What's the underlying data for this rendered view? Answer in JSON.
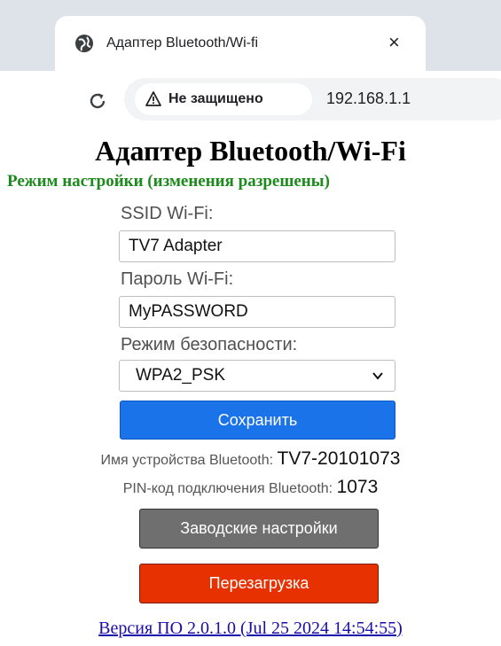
{
  "browser": {
    "tab": {
      "title": "Адаптер Bluetooth/Wi-fi",
      "favicon": "globe-icon",
      "close": "×"
    },
    "toolbar": {
      "reload_icon": "reload-icon",
      "security_label": "Не защищено",
      "security_icon": "warning-triangle-icon",
      "url": "192.168.1.1"
    }
  },
  "page": {
    "title": "Адаптер Bluetooth/Wi-Fi",
    "mode_text": "Режим настройки (изменения разрешены)",
    "ssid": {
      "label": "SSID Wi-Fi:",
      "value": "TV7 Adapter"
    },
    "password": {
      "label": "Пароль Wi-Fi:",
      "value": "MyPASSWORD"
    },
    "security": {
      "label": "Режим безопасности:",
      "selected": "WPA2_PSK"
    },
    "save_button": "Сохранить",
    "device_name": {
      "label": "Имя устройства Bluetooth:",
      "value": "TV7-20101073"
    },
    "pin": {
      "label": "PIN-код подключения Bluetooth:",
      "value": "1073"
    },
    "factory_button": "Заводские настройки",
    "reboot_button": "Перезагрузка",
    "version_link": "Версия ПО 2.0.1.0 (Jul 25 2024 14:54:55)"
  },
  "colors": {
    "mode_text": "#1c8a1c",
    "save": "#1a73e8",
    "factory": "#6f6f6f",
    "reboot": "#e83100",
    "link": "#1a0dab"
  }
}
